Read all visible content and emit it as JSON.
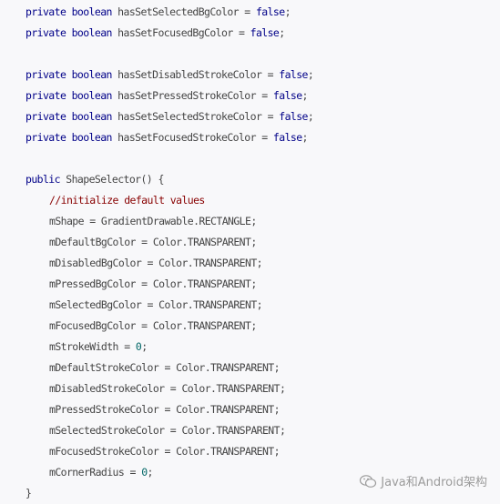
{
  "lines": [
    {
      "kind": "field",
      "keyword": "private boolean",
      "name": " hasSetSelectedBgColor = ",
      "value": "false",
      "end": ";"
    },
    {
      "kind": "field",
      "keyword": "private boolean",
      "name": " hasSetFocusedBgColor = ",
      "value": "false",
      "end": ";"
    },
    {
      "kind": "blank"
    },
    {
      "kind": "field",
      "keyword": "private boolean",
      "name": " hasSetDisabledStrokeColor = ",
      "value": "false",
      "end": ";"
    },
    {
      "kind": "field",
      "keyword": "private boolean",
      "name": " hasSetPressedStrokeColor = ",
      "value": "false",
      "end": ";"
    },
    {
      "kind": "field",
      "keyword": "private boolean",
      "name": " hasSetSelectedStrokeColor = ",
      "value": "false",
      "end": ";"
    },
    {
      "kind": "field",
      "keyword": "private boolean",
      "name": " hasSetFocusedStrokeColor = ",
      "value": "false",
      "end": ";"
    },
    {
      "kind": "blank"
    },
    {
      "kind": "ctor",
      "keyword": "public",
      "rest": " ShapeSelector() {"
    },
    {
      "kind": "comment",
      "text": "//initialize default values"
    },
    {
      "kind": "stmt",
      "text": "mShape = GradientDrawable.RECTANGLE;"
    },
    {
      "kind": "stmt",
      "text": "mDefaultBgColor = Color.TRANSPARENT;"
    },
    {
      "kind": "stmt",
      "text": "mDisabledBgColor = Color.TRANSPARENT;"
    },
    {
      "kind": "stmt",
      "text": "mPressedBgColor = Color.TRANSPARENT;"
    },
    {
      "kind": "stmt",
      "text": "mSelectedBgColor = Color.TRANSPARENT;"
    },
    {
      "kind": "stmt",
      "text": "mFocusedBgColor = Color.TRANSPARENT;"
    },
    {
      "kind": "num",
      "name": "mStrokeWidth = ",
      "value": "0",
      "end": ";"
    },
    {
      "kind": "stmt",
      "text": "mDefaultStrokeColor = Color.TRANSPARENT;"
    },
    {
      "kind": "stmt",
      "text": "mDisabledStrokeColor = Color.TRANSPARENT;"
    },
    {
      "kind": "stmt",
      "text": "mPressedStrokeColor = Color.TRANSPARENT;"
    },
    {
      "kind": "stmt",
      "text": "mSelectedStrokeColor = Color.TRANSPARENT;"
    },
    {
      "kind": "stmt",
      "text": "mFocusedStrokeColor = Color.TRANSPARENT;"
    },
    {
      "kind": "num",
      "name": "mCornerRadius = ",
      "value": "0",
      "end": ";"
    },
    {
      "kind": "close",
      "text": "}"
    }
  ],
  "watermark": {
    "text": "Java和Android架构",
    "icon": "wechat-icon"
  },
  "colors": {
    "keyword": "#000088",
    "literal": "#006666",
    "comment": "#880000",
    "text": "#444444",
    "background": "#f8f8fa"
  }
}
